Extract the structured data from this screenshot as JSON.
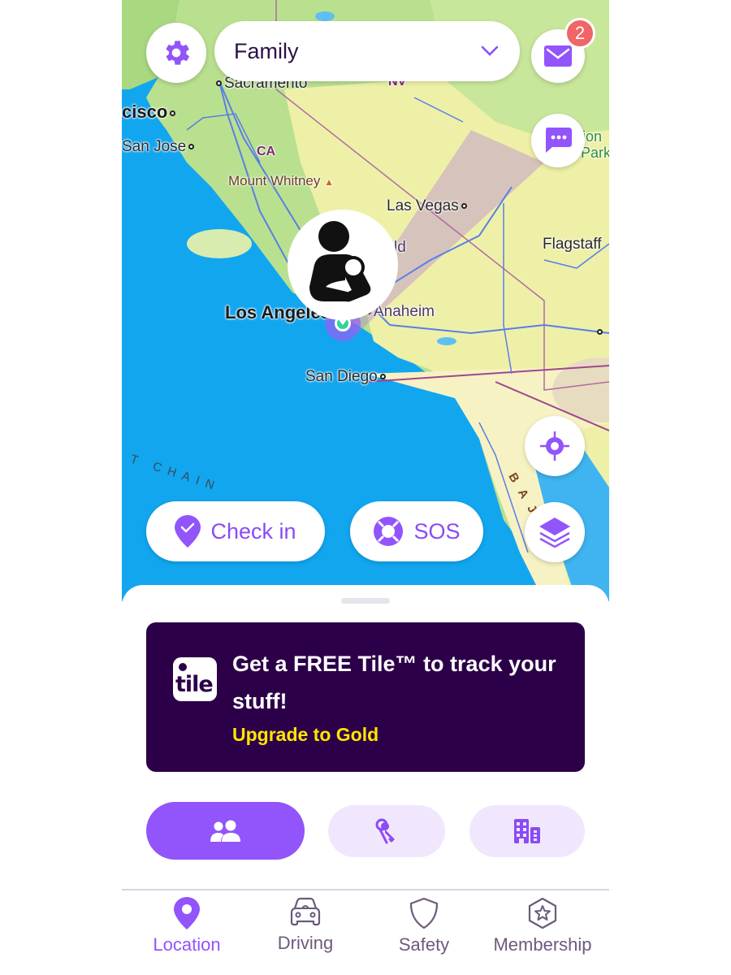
{
  "header": {
    "circle_name": "Family",
    "settings_icon": "gear-icon",
    "dropdown_icon": "chevron-down-icon",
    "inbox_icon": "envelope-icon",
    "inbox_badge_count": "2",
    "chat_icon": "chat-bubble-icon"
  },
  "map": {
    "labels": {
      "sacramento": "Sacramento",
      "san_francisco": "cisco",
      "san_jose": "San Jose",
      "ca": "CA",
      "nv": "NV",
      "mount_whitney": "Mount Whitney",
      "las_vegas": "Las Vegas",
      "flagstaff": "Flagstaff",
      "zion": "ion",
      "park": "Park",
      "bakersfield_fragment": "ld",
      "los_angeles": "Los Angeles",
      "anaheim": "Anaheim",
      "san_diego": "San Diego",
      "chain": "T CHAIN",
      "baja": "BAJA C"
    },
    "member_avatar_icon": "parent-with-baby-icon",
    "recenter_icon": "crosshair-icon",
    "layers_icon": "layers-icon"
  },
  "actions": {
    "check_in": "Check in",
    "check_in_icon": "map-pin-check-icon",
    "sos": "SOS",
    "sos_icon": "lifebuoy-icon"
  },
  "promo": {
    "logo_text": "tile",
    "title": "Get a FREE Tile™ to track your stuff!",
    "cta": "Upgrade to Gold"
  },
  "segments": [
    {
      "name": "people",
      "icon": "people-icon",
      "active": true
    },
    {
      "name": "items",
      "icon": "keys-icon",
      "active": false
    },
    {
      "name": "places",
      "icon": "building-icon",
      "active": false
    }
  ],
  "tabs": [
    {
      "label": "Location",
      "icon": "location-pin-icon",
      "active": true
    },
    {
      "label": "Driving",
      "icon": "car-icon",
      "active": false
    },
    {
      "label": "Safety",
      "icon": "shield-icon",
      "active": false
    },
    {
      "label": "Membership",
      "icon": "star-badge-icon",
      "active": false
    }
  ],
  "colors": {
    "accent": "#9254fb",
    "promo_bg": "#2c0048",
    "promo_cta": "#ffe600",
    "badge": "#f06565",
    "location_dot": "#34d399"
  }
}
